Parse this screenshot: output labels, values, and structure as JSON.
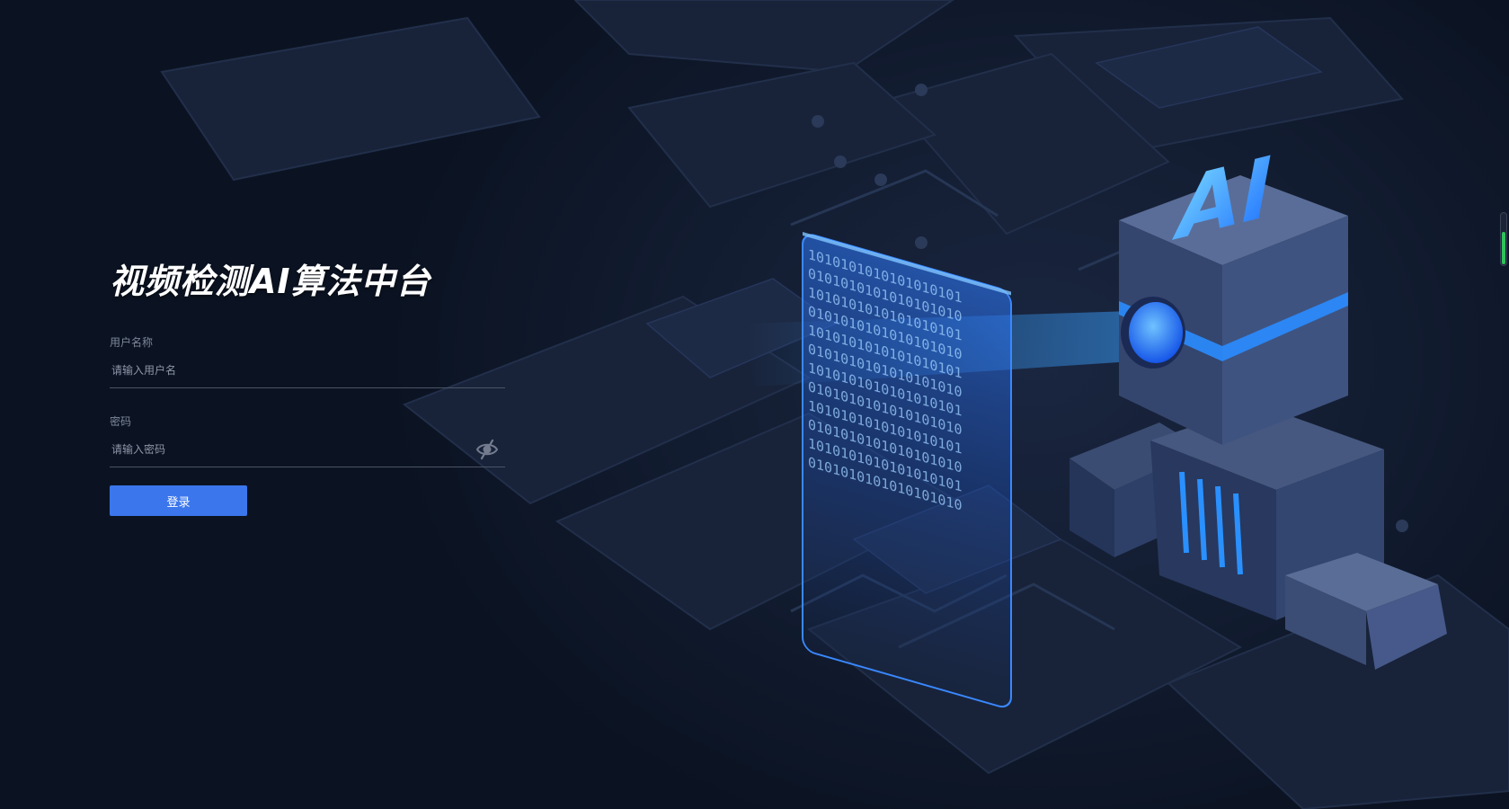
{
  "app": {
    "title": "视频检测AI算法中台"
  },
  "login_form": {
    "username": {
      "label": "用户名称",
      "placeholder": "请输入用户名",
      "value": ""
    },
    "password": {
      "label": "密码",
      "placeholder": "请输入密码",
      "value": "",
      "visibility_icon": "eye-slash-icon"
    },
    "submit_label": "登录"
  },
  "illustration": {
    "badge_text": "AI",
    "binary_rows": [
      "1010101010101010101",
      "0101010101010101010",
      "1010101010101010101",
      "0101010101010101010",
      "1010101010101010101",
      "0101010101010101010",
      "1010101010101010101",
      "0101010101010101010",
      "1010101010101010101",
      "0101010101010101010",
      "1010101010101010101",
      "0101010101010101010"
    ]
  },
  "scroll_indicator": {
    "level": 0.62
  },
  "colors": {
    "background": "#0b1322",
    "accent": "#3b76ed",
    "glow": "#2a8cff",
    "indicator": "#2ec25a"
  }
}
